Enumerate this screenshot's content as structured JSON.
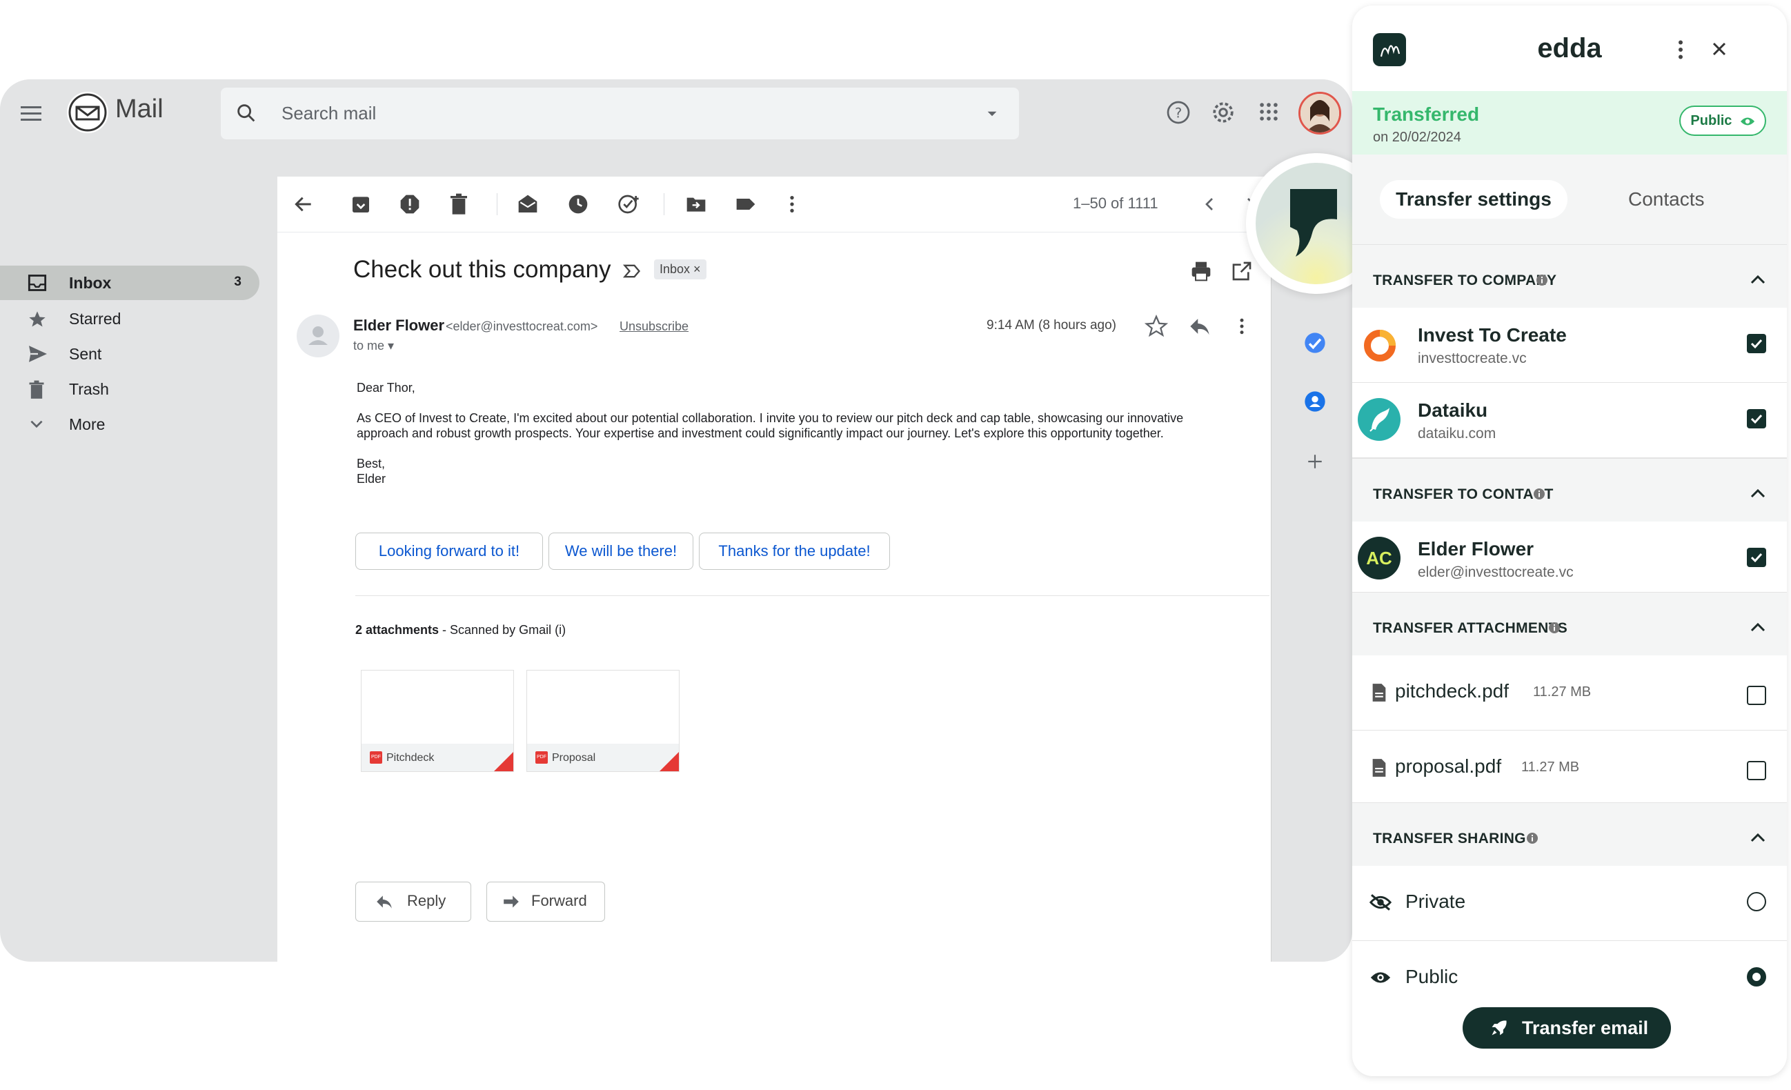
{
  "gmail": {
    "app_name": "Mail",
    "search_placeholder": "Search mail",
    "nav": [
      {
        "label": "Inbox",
        "count": "3"
      },
      {
        "label": "Starred"
      },
      {
        "label": "Sent"
      },
      {
        "label": "Trash"
      },
      {
        "label": "More"
      }
    ],
    "pager": "1–50 of 1111",
    "email": {
      "subject": "Check out this company",
      "label_chip": "Inbox ×",
      "sender_name": "Elder Flower",
      "sender_email": "<elder@investtocreat.com>",
      "unsubscribe": "Unsubscribe",
      "to": "to me ▾",
      "time": "9:14 AM (8 hours ago)",
      "greeting": "Dear Thor,",
      "body": "As CEO of Invest to Create, I'm excited about our potential collaboration. I invite you to review our pitch deck and cap table, showcasing our innovative approach and robust growth prospects. Your expertise and investment could significantly impact our journey. Let's explore this opportunity together.",
      "signoff_1": "Best,",
      "signoff_2": "Elder"
    },
    "smart_replies": [
      "Looking forward to it!",
      "We will be there!",
      "Thanks for the update!"
    ],
    "attachments": {
      "count_label": "2 attachments",
      "scan_label": " - Scanned by Gmail (i)",
      "files": [
        "Pitchdeck",
        "Proposal"
      ]
    },
    "actions": {
      "reply": "Reply",
      "forward": "Forward"
    }
  },
  "edda": {
    "title": "edda",
    "status": "Transferred",
    "status_date": "on 20/02/2024",
    "visibility_badge": "Public",
    "tabs": {
      "settings": "Transfer settings",
      "contacts": "Contacts"
    },
    "sections": {
      "company": "TRANSFER TO COMPANY",
      "contact": "TRANSFER TO CONTACT",
      "attachments": "TRANSFER ATTACHMENTS",
      "sharing": "TRANSFER SHARING"
    },
    "companies": [
      {
        "name": "Invest To Create",
        "domain": "investtocreate.vc",
        "checked": true
      },
      {
        "name": "Dataiku",
        "domain": "dataiku.com",
        "checked": true
      }
    ],
    "contact": {
      "initials": "AC",
      "name": "Elder Flower",
      "email": "elder@investtocreate.vc",
      "checked": true
    },
    "files": [
      {
        "name": "pitchdeck.pdf",
        "size": "11.27 MB",
        "checked": false
      },
      {
        "name": "proposal.pdf",
        "size": "11.27 MB",
        "checked": false
      }
    ],
    "sharing": {
      "private": "Private",
      "public": "Public",
      "selected": "Public"
    },
    "transfer_button": "Transfer email",
    "colors": {
      "accent": "#35b76c",
      "dark": "#14302c",
      "status_bg": "#e2f8ea"
    }
  }
}
